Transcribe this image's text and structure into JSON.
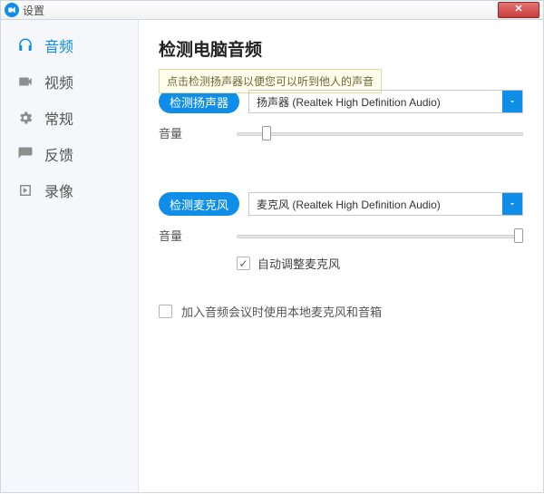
{
  "window": {
    "title": "设置"
  },
  "sidebar": {
    "items": [
      {
        "label": "音频"
      },
      {
        "label": "视频"
      },
      {
        "label": "常规"
      },
      {
        "label": "反馈"
      },
      {
        "label": "录像"
      }
    ]
  },
  "main": {
    "title": "检测电脑音频",
    "tooltip": "点击检测扬声器以便您可以听到他人的声音",
    "speaker": {
      "button": "检测扬声器",
      "selected": "扬声器 (Realtek High Definition Audio)",
      "volume_label": "音量"
    },
    "mic": {
      "button": "检测麦克风",
      "selected": "麦克风 (Realtek High Definition Audio)",
      "volume_label": "音量",
      "auto_adjust": "自动调整麦克风"
    },
    "join_option": "加入音频会议时使用本地麦克风和音箱"
  }
}
